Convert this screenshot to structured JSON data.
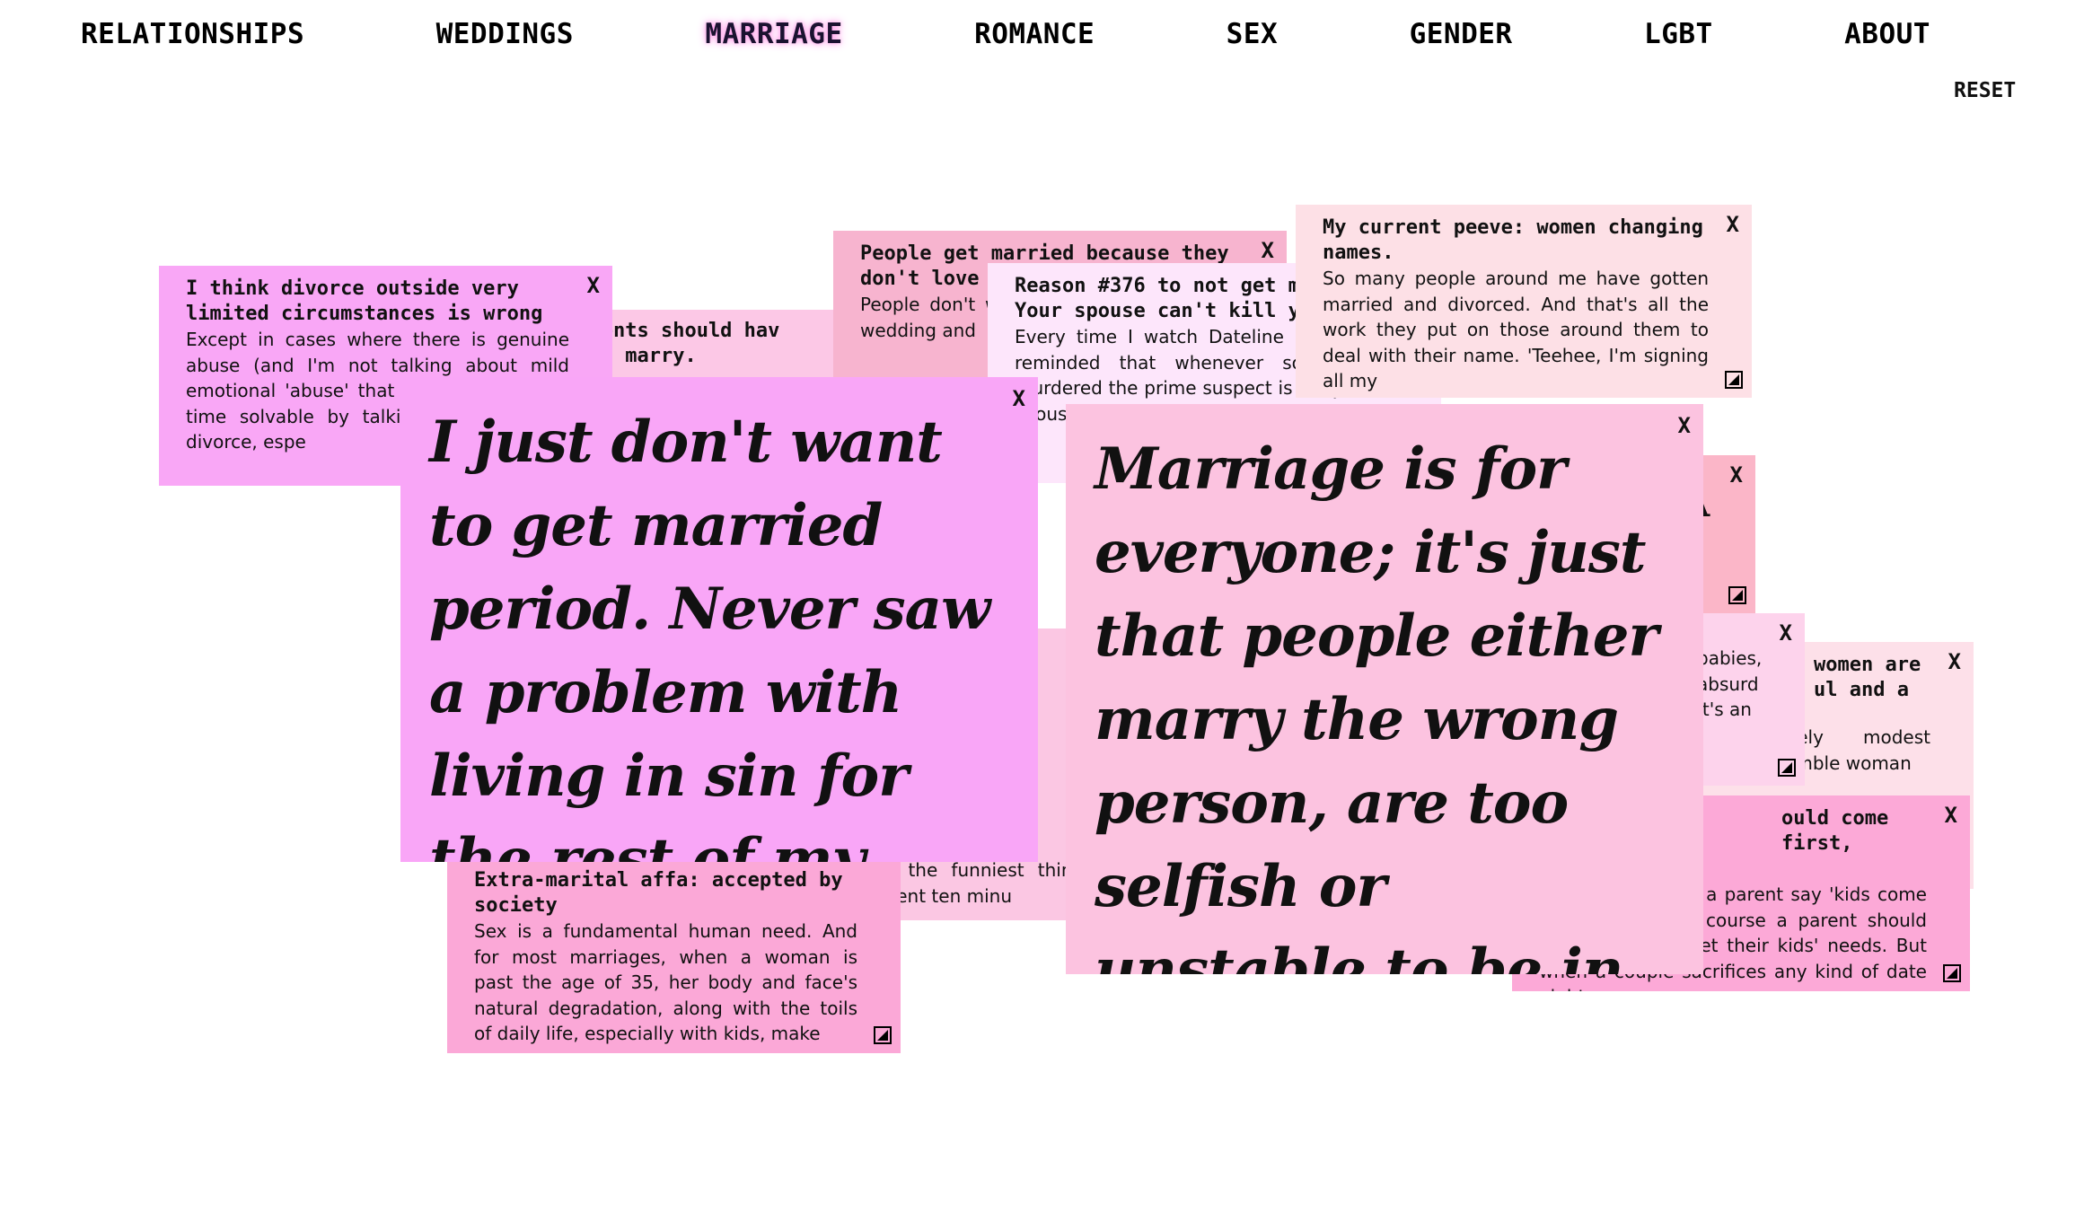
{
  "nav": {
    "items": [
      {
        "label": "RELATIONSHIPS",
        "name": "nav-relationships"
      },
      {
        "label": "WEDDINGS",
        "name": "nav-weddings"
      },
      {
        "label": "MARRIAGE",
        "name": "nav-marriage",
        "active": true
      },
      {
        "label": "ROMANCE",
        "name": "nav-romance"
      },
      {
        "label": "SEX",
        "name": "nav-sex"
      },
      {
        "label": "GENDER",
        "name": "nav-gender"
      },
      {
        "label": "LGBT",
        "name": "nav-lgbt"
      },
      {
        "label": "ABOUT",
        "name": "nav-about"
      }
    ]
  },
  "reset_label": "RESET",
  "close_label": "X",
  "cards": [
    {
      "id": "c-parents",
      "color": "#fcc8e6",
      "title": "parents should hav\ns to marry.",
      "body": ""
    },
    {
      "id": "c-divorce",
      "color": "#f9a7f6",
      "title": "I think divorce outside very limited circumstances is wrong",
      "body": "Except in cases where there is genuine abuse (and I'm not talking about mild emotional 'abuse' that relationships from time solvable by talking) I t wrong to divorce, espe"
    },
    {
      "id": "c-love",
      "color": "#f7b4cf",
      "title": "People get married because they don't love",
      "body": "People don't why they get an expensive wedding and"
    },
    {
      "id": "c-extra",
      "color": "#fba8d7",
      "title": "Extra-marital affa: accepted by society",
      "body": "Sex is a fundamental human need. And for most marriages, when a woman is past the age of 35, her body and face's natural degradation, along with the toils of daily life, especially with kids, make"
    },
    {
      "id": "c-funniest",
      "color": "#fbc7e3",
      "title": "",
      "body": "thought it was the funniest thing ever heard of, and spent ten minu"
    },
    {
      "id": "c-reason",
      "color": "#fde6fb",
      "title": "Reason #376 to not get married: Your spouse can't kill you!",
      "body": "Every time I watch Dateline MSNBC I'm reminded that whenever someone is murdered the prime suspect is the jealous spouse, usually"
    },
    {
      "id": "c-peeve",
      "color": "#fde0e6",
      "title": "My current peeve: women changing names.",
      "body": "So many people around me have gotten married and divorced. And that's all the work they put on those around them to deal with their name. 'Teehee, I'm signing all my"
    },
    {
      "id": "c-pinkA",
      "color": "#fbb6c8",
      "title": "",
      "body": ""
    },
    {
      "id": "c-babies",
      "color": "#fdd3ec",
      "title": "",
      "body": "babies, absurd It's an"
    },
    {
      "id": "c-women",
      "color": "#fde0e9",
      "title": "women are ul and a",
      "body": "extremely modest and humble woman"
    },
    {
      "id": "c-first",
      "color": "#fca9d7",
      "title": "ould come first,",
      "body": "Every time I hear a parent say 'kids come first'. I mean, of course a parent should make sure to meet their kids' needs. But when a couple sacrifices any kind of date nights or"
    },
    {
      "id": "c-dontwant",
      "color": "#f9a6f7",
      "title": "I just don't want to get married period. Never saw a problem with living in sin for the rest of my life.",
      "body": ""
    },
    {
      "id": "c-everyone",
      "color": "#fcc3e0",
      "title": "Marriage is for everyone; it's just that people either marry the wrong person, are too selfish or unstable to be in a marriage",
      "body": ""
    }
  ]
}
